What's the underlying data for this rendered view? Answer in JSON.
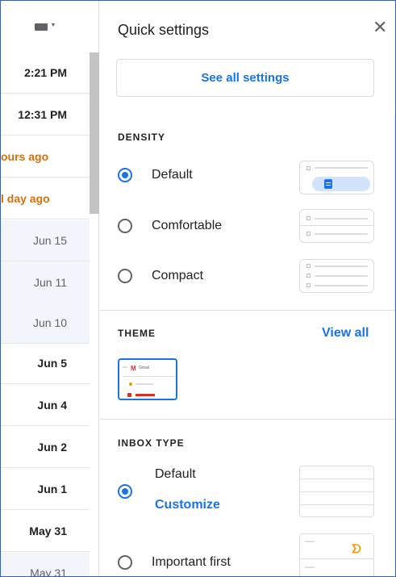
{
  "email_list": {
    "rows": [
      {
        "time": "2:21 PM",
        "state": "unread"
      },
      {
        "time": "12:31 PM",
        "state": "unread"
      },
      {
        "time": "ours ago",
        "state": "orange"
      },
      {
        "time": "l day ago",
        "state": "orange"
      },
      {
        "time": "Jun 15",
        "state": "read"
      },
      {
        "time": "Jun 11",
        "state": "read"
      },
      {
        "time": "Jun 10",
        "state": "read"
      },
      {
        "time": "Jun 5",
        "state": "unread"
      },
      {
        "time": "Jun 4",
        "state": "unread"
      },
      {
        "time": "Jun 2",
        "state": "unread"
      },
      {
        "time": "Jun 1",
        "state": "unread"
      },
      {
        "time": "May 31",
        "state": "unread"
      },
      {
        "time": "May 31",
        "state": "read"
      }
    ]
  },
  "quick_settings": {
    "title": "Quick settings",
    "close_icon": "close-icon",
    "see_all": "See all settings",
    "density": {
      "label": "DENSITY",
      "options": [
        {
          "label": "Default",
          "selected": true
        },
        {
          "label": "Comfortable",
          "selected": false
        },
        {
          "label": "Compact",
          "selected": false
        }
      ]
    },
    "theme": {
      "label": "THEME",
      "view_all": "View all",
      "thumb_text": "Gmail"
    },
    "inbox_type": {
      "label": "INBOX TYPE",
      "default_label": "Default",
      "customize": "Customize",
      "default_selected": true,
      "important_label": "Important first",
      "important_selected": false
    }
  },
  "colors": {
    "accent": "#1a73e8",
    "unread_orange": "#d56e0c",
    "frame_border": "#3b5fa8"
  }
}
